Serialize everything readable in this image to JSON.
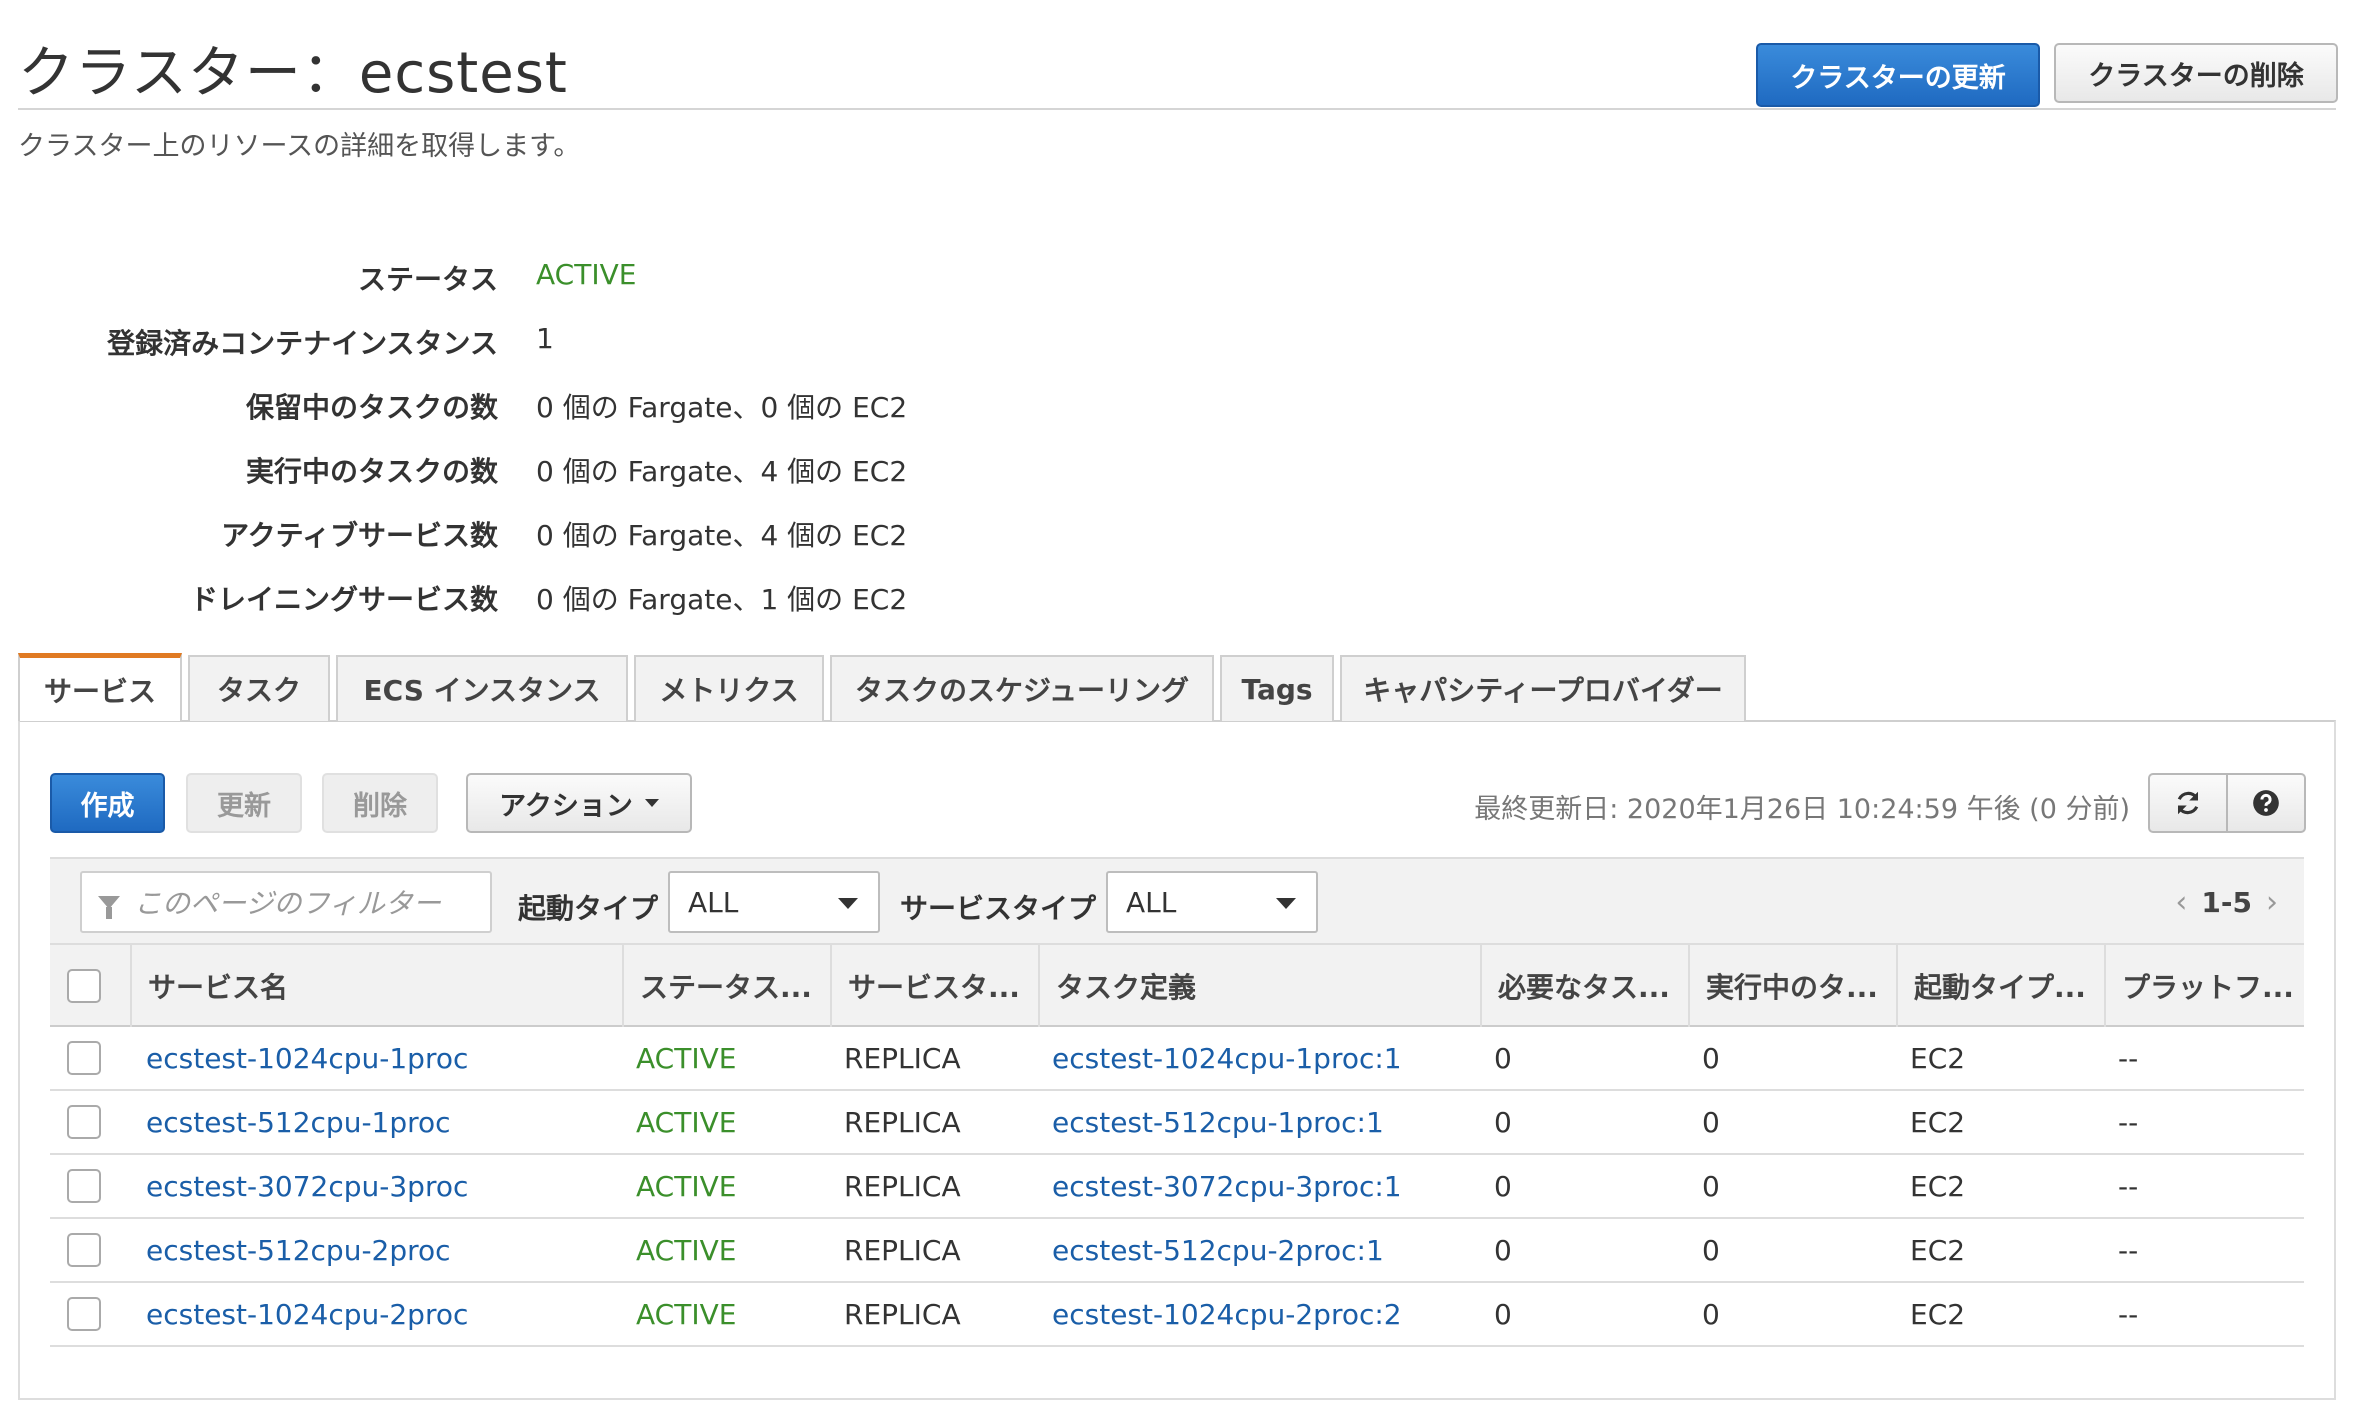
{
  "header": {
    "title": "クラスター：ecstest",
    "subtitle": "クラスター上のリソースの詳細を取得します。",
    "update_button": "クラスターの更新",
    "delete_button": "クラスターの削除"
  },
  "details": [
    {
      "label": "ステータス",
      "value": "ACTIVE"
    },
    {
      "label": "登録済みコンテナインスタンス",
      "value": "1"
    },
    {
      "label": "保留中のタスクの数",
      "value": "0 個の Fargate、0 個の EC2"
    },
    {
      "label": "実行中のタスクの数",
      "value": "0 個の Fargate、4 個の EC2"
    },
    {
      "label": "アクティブサービス数",
      "value": "0 個の Fargate、4 個の EC2"
    },
    {
      "label": "ドレイニングサービス数",
      "value": "0 個の Fargate、1 個の EC2"
    }
  ],
  "tabs": [
    {
      "label": "サービス",
      "selected": true
    },
    {
      "label": "タスク"
    },
    {
      "label": "ECS インスタンス"
    },
    {
      "label": "メトリクス"
    },
    {
      "label": "タスクのスケジューリング"
    },
    {
      "label": "Tags"
    },
    {
      "label": "キャパシティープロバイダー"
    }
  ],
  "toolbar": {
    "create": "作成",
    "refresh": "更新",
    "delete": "削除",
    "actions": "アクション",
    "last_updated": "最終更新日: 2020年1月26日 10:24:59 午後 (0 分前)"
  },
  "filter": {
    "placeholder": "このページのフィルター",
    "launch_type_label": "起動タイプ",
    "launch_type_value": "ALL",
    "service_type_label": "サービスタイプ",
    "service_type_value": "ALL",
    "pagination": "1-5"
  },
  "table": {
    "columns": [
      "サービス名",
      "ステータス...",
      "サービスタ...",
      "タスク定義",
      "必要なタス...",
      "実行中のタ...",
      "起動タイプ...",
      "プラットフ..."
    ],
    "rows": [
      {
        "name": "ecstest-1024cpu-1proc",
        "status": "ACTIVE",
        "service_type": "REPLICA",
        "task_def": "ecstest-1024cpu-1proc:1",
        "desired": "0",
        "running": "0",
        "launch_type": "EC2",
        "platform": "--"
      },
      {
        "name": "ecstest-512cpu-1proc",
        "status": "ACTIVE",
        "service_type": "REPLICA",
        "task_def": "ecstest-512cpu-1proc:1",
        "desired": "0",
        "running": "0",
        "launch_type": "EC2",
        "platform": "--"
      },
      {
        "name": "ecstest-3072cpu-3proc",
        "status": "ACTIVE",
        "service_type": "REPLICA",
        "task_def": "ecstest-3072cpu-3proc:1",
        "desired": "0",
        "running": "0",
        "launch_type": "EC2",
        "platform": "--"
      },
      {
        "name": "ecstest-512cpu-2proc",
        "status": "ACTIVE",
        "service_type": "REPLICA",
        "task_def": "ecstest-512cpu-2proc:1",
        "desired": "0",
        "running": "0",
        "launch_type": "EC2",
        "platform": "--"
      },
      {
        "name": "ecstest-1024cpu-2proc",
        "status": "ACTIVE",
        "service_type": "REPLICA",
        "task_def": "ecstest-1024cpu-2proc:2",
        "desired": "0",
        "running": "0",
        "launch_type": "EC2",
        "platform": "--"
      }
    ]
  },
  "colors": {
    "primary": "#1f6ac1",
    "active_status": "#3b8f2b",
    "link": "#1a5ea8",
    "tab_accent": "#e07a22"
  }
}
